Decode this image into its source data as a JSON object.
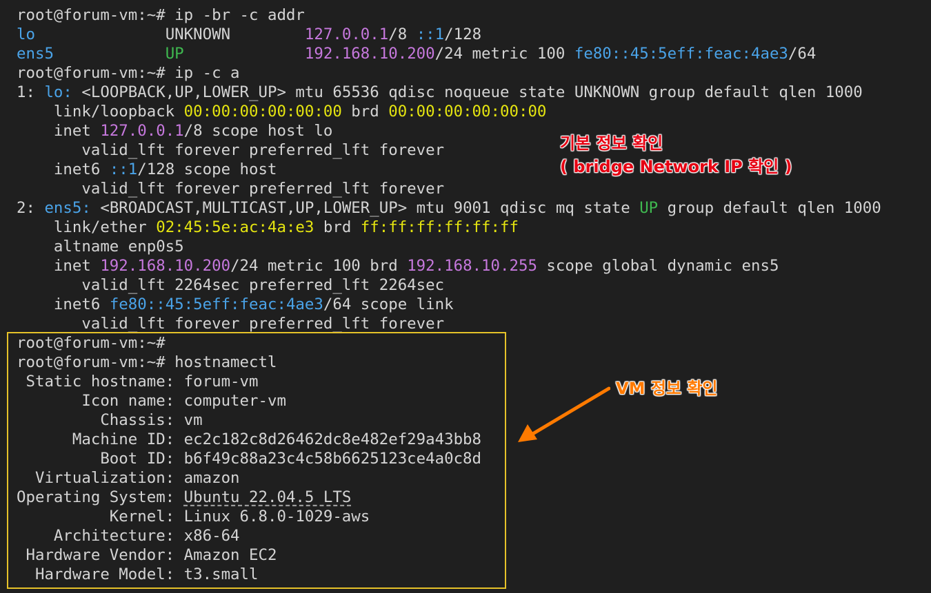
{
  "terminal": {
    "lines": [
      [
        {
          "t": "root@forum-vm:~# ip -br -c addr",
          "c": "default"
        }
      ],
      [
        {
          "t": "lo",
          "c": "blue"
        },
        {
          "t": "              ",
          "c": "default"
        },
        {
          "t": "UNKNOWN",
          "c": "default"
        },
        {
          "t": "        ",
          "c": "default"
        },
        {
          "t": "127.0.0.1",
          "c": "purple"
        },
        {
          "t": "/8 ",
          "c": "default"
        },
        {
          "t": "::1",
          "c": "blue"
        },
        {
          "t": "/128",
          "c": "default"
        }
      ],
      [
        {
          "t": "ens5",
          "c": "blue"
        },
        {
          "t": "            ",
          "c": "default"
        },
        {
          "t": "UP",
          "c": "green"
        },
        {
          "t": "             ",
          "c": "default"
        },
        {
          "t": "192.168.10.200",
          "c": "purple"
        },
        {
          "t": "/24 metric 100 ",
          "c": "default"
        },
        {
          "t": "fe80::45:5eff:feac:4ae3",
          "c": "blue"
        },
        {
          "t": "/64",
          "c": "default"
        }
      ],
      [
        {
          "t": "root@forum-vm:~# ip -c a",
          "c": "default"
        }
      ],
      [
        {
          "t": "1: ",
          "c": "default"
        },
        {
          "t": "lo:",
          "c": "blue"
        },
        {
          "t": " <LOOPBACK,UP,LOWER_UP> mtu 65536 qdisc noqueue state UNKNOWN group default qlen 1000",
          "c": "default"
        }
      ],
      [
        {
          "t": "    link/loopback ",
          "c": "default"
        },
        {
          "t": "00:00:00:00:00:00",
          "c": "yellow"
        },
        {
          "t": " brd ",
          "c": "default"
        },
        {
          "t": "00:00:00:00:00:00",
          "c": "yellow"
        }
      ],
      [
        {
          "t": "    inet ",
          "c": "default"
        },
        {
          "t": "127.0.0.1",
          "c": "purple"
        },
        {
          "t": "/8 scope host lo",
          "c": "default"
        }
      ],
      [
        {
          "t": "       valid_lft forever preferred_lft forever",
          "c": "default"
        }
      ],
      [
        {
          "t": "    inet6 ",
          "c": "default"
        },
        {
          "t": "::1",
          "c": "blue"
        },
        {
          "t": "/128 scope host",
          "c": "default"
        }
      ],
      [
        {
          "t": "       valid_lft forever preferred_lft forever",
          "c": "default"
        }
      ],
      [
        {
          "t": "2: ",
          "c": "default"
        },
        {
          "t": "ens5:",
          "c": "blue"
        },
        {
          "t": " <BROADCAST,MULTICAST,UP,LOWER_UP> mtu 9001 qdisc mq state ",
          "c": "default"
        },
        {
          "t": "UP",
          "c": "green"
        },
        {
          "t": " group default qlen 1000",
          "c": "default"
        }
      ],
      [
        {
          "t": "    link/ether ",
          "c": "default"
        },
        {
          "t": "02:45:5e:ac:4a:e3",
          "c": "yellow"
        },
        {
          "t": " brd ",
          "c": "default"
        },
        {
          "t": "ff:ff:ff:ff:ff:ff",
          "c": "yellow"
        }
      ],
      [
        {
          "t": "    altname enp0s5",
          "c": "default"
        }
      ],
      [
        {
          "t": "    inet ",
          "c": "default"
        },
        {
          "t": "192.168.10.200",
          "c": "purple"
        },
        {
          "t": "/24 metric 100 brd ",
          "c": "default"
        },
        {
          "t": "192.168.10.255",
          "c": "purple"
        },
        {
          "t": " scope global dynamic ens5",
          "c": "default"
        }
      ],
      [
        {
          "t": "       valid_lft 2264sec preferred_lft 2264sec",
          "c": "default"
        }
      ],
      [
        {
          "t": "    inet6 ",
          "c": "default"
        },
        {
          "t": "fe80::45:5eff:feac:4ae3",
          "c": "blue"
        },
        {
          "t": "/64 scope link",
          "c": "default"
        }
      ],
      [
        {
          "t": "       valid_lft forever preferred_lft forever",
          "c": "default"
        }
      ],
      [
        {
          "t": "root@forum-vm:~#",
          "c": "default"
        }
      ],
      [
        {
          "t": "root@forum-vm:~# hostnamectl",
          "c": "default"
        }
      ],
      [
        {
          "t": " Static hostname: forum-vm",
          "c": "default"
        }
      ],
      [
        {
          "t": "       Icon name: computer-vm",
          "c": "default"
        }
      ],
      [
        {
          "t": "         Chassis: vm",
          "c": "default"
        }
      ],
      [
        {
          "t": "      Machine ID: ec2c182c8d26462dc8e482ef29a43bb8",
          "c": "default"
        }
      ],
      [
        {
          "t": "         Boot ID: b6f49c88a23c4c58b6625123ce4a0c8d",
          "c": "default"
        }
      ],
      [
        {
          "t": "  Virtualization: amazon",
          "c": "default"
        }
      ],
      [
        {
          "t": "Operating System: ",
          "c": "default"
        },
        {
          "t": "Ubuntu 22.04.5 LTS",
          "c": "ul"
        }
      ],
      [
        {
          "t": "          Kernel: Linux 6.8.0-1029-aws",
          "c": "default"
        }
      ],
      [
        {
          "t": "    Architecture: x86-64",
          "c": "default"
        }
      ],
      [
        {
          "t": " Hardware Vendor: Amazon EC2",
          "c": "default"
        }
      ],
      [
        {
          "t": "  Hardware Model: t3.small",
          "c": "default"
        }
      ]
    ]
  },
  "annotations": {
    "network_note": "기본 정보 확인\n( bridge Network IP 확인 )",
    "vm_note": "VM 정보 확인"
  },
  "colors": {
    "background": "#1f1f1f",
    "text": "#d4d4d4",
    "purple": "#c678dd",
    "blue": "#4aa3e8",
    "green": "#3fb950",
    "yellow": "#e5e510",
    "highlight_box": "#e6c229",
    "annotation_red": "#e60012",
    "annotation_orange": "#ff7a00"
  }
}
